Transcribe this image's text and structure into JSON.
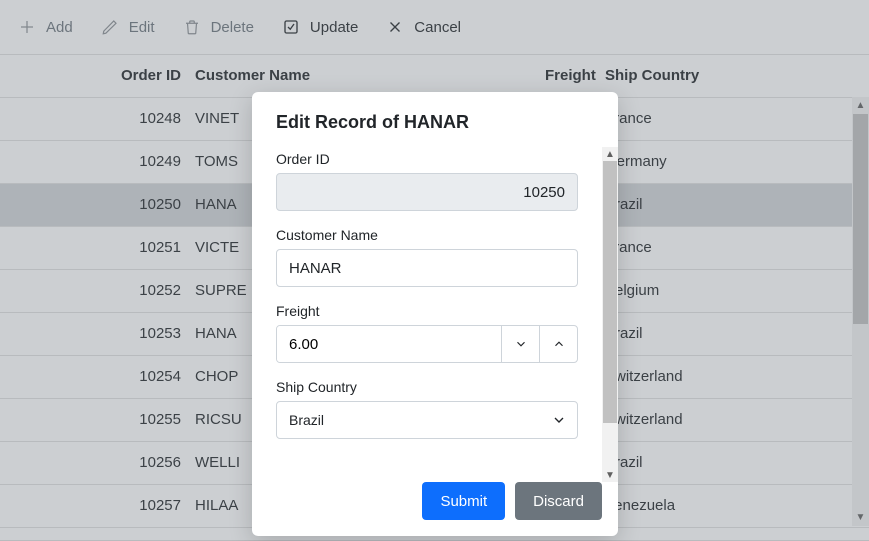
{
  "toolbar": {
    "add": "Add",
    "edit": "Edit",
    "delete": "Delete",
    "update": "Update",
    "cancel": "Cancel"
  },
  "columns": {
    "order_id": "Order ID",
    "customer_name": "Customer Name",
    "freight": "Freight",
    "ship_country": "Ship Country"
  },
  "rows": [
    {
      "order_id": "10248",
      "customer": "VINET",
      "ship_country": "France"
    },
    {
      "order_id": "10249",
      "customer": "TOMS",
      "ship_country": "Germany"
    },
    {
      "order_id": "10250",
      "customer": "HANA",
      "ship_country": "Brazil",
      "selected": true
    },
    {
      "order_id": "10251",
      "customer": "VICTE",
      "ship_country": "France"
    },
    {
      "order_id": "10252",
      "customer": "SUPRE",
      "ship_country": "Belgium"
    },
    {
      "order_id": "10253",
      "customer": "HANA",
      "ship_country": "Brazil"
    },
    {
      "order_id": "10254",
      "customer": "CHOP",
      "ship_country": "Switzerland"
    },
    {
      "order_id": "10255",
      "customer": "RICSU",
      "ship_country": "Switzerland"
    },
    {
      "order_id": "10256",
      "customer": "WELLI",
      "ship_country": "Brazil"
    },
    {
      "order_id": "10257",
      "customer": "HILAA",
      "ship_country": "Venezuela"
    }
  ],
  "dialog": {
    "title": "Edit Record of HANAR",
    "fields": {
      "order_id": {
        "label": "Order ID",
        "value": "10250"
      },
      "customer_name": {
        "label": "Customer Name",
        "value": "HANAR"
      },
      "freight": {
        "label": "Freight",
        "value": "6.00"
      },
      "ship_country": {
        "label": "Ship Country",
        "value": "Brazil"
      }
    },
    "submit": "Submit",
    "discard": "Discard"
  }
}
